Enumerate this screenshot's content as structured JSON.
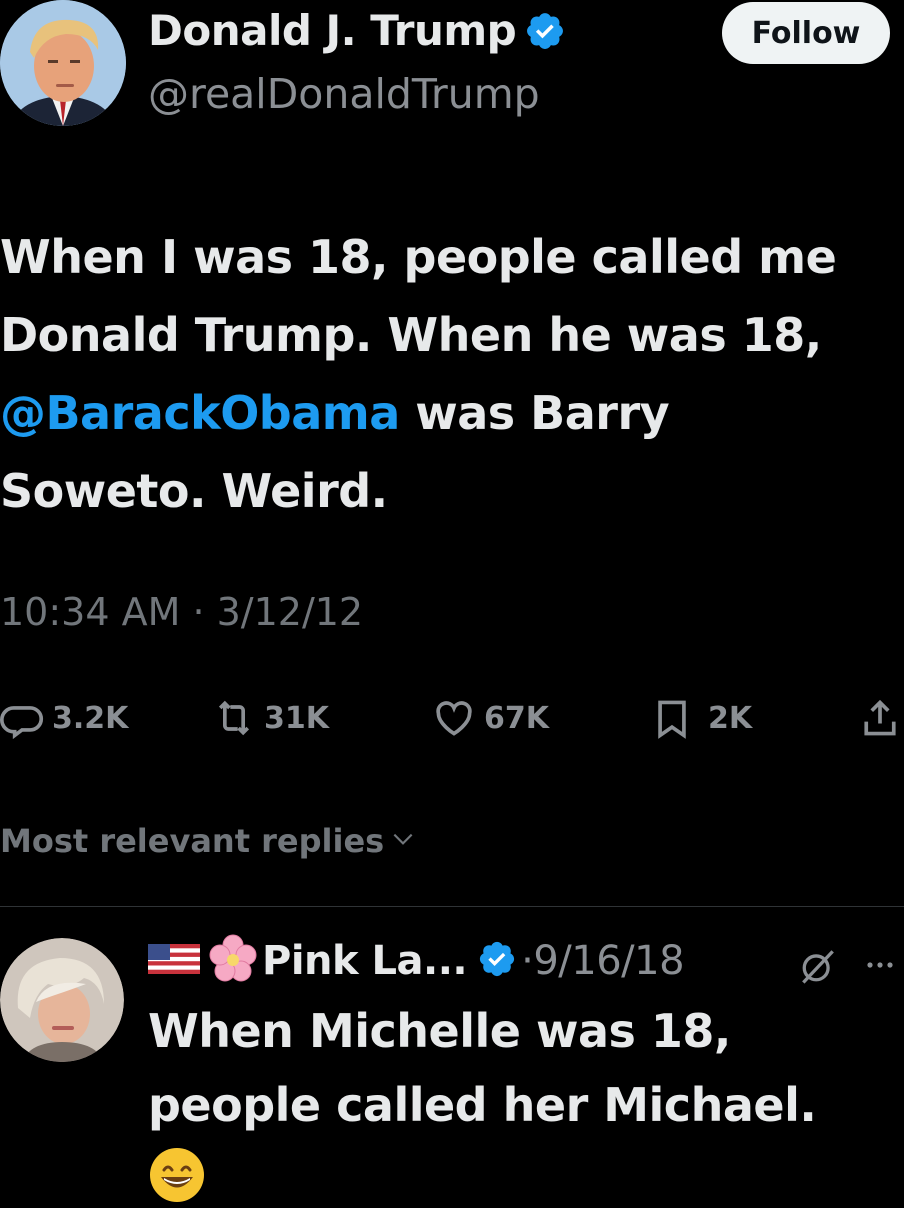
{
  "tweet": {
    "author": {
      "display_name": "Donald J. Trump",
      "handle": "@realDonaldTrump",
      "verified": true
    },
    "follow_label": "Follow",
    "text_lines": [
      "When I was 18, people called me",
      "Donald Trump. When he was 18,"
    ],
    "mention": "@BarackObama",
    "line3_rest": " was Barry",
    "line4": "Soweto. Weird.",
    "timestamp": "10:34 AM · 3/12/12",
    "stats": {
      "replies": "3.2K",
      "reposts": "31K",
      "likes": "67K",
      "bookmarks": "2K"
    },
    "icons": {
      "reply": "comment-icon",
      "repost": "repost-icon",
      "like": "heart-icon",
      "bookmark": "bookmark-icon",
      "share": "share-icon"
    }
  },
  "replies_sort_label": "Most relevant replies",
  "reply": {
    "display_name": "Pink La...",
    "date": "·9/16/18",
    "verified": true,
    "text_lines": [
      "When Michelle was 18,",
      "people called her Michael."
    ],
    "emoji": "😁"
  },
  "colors": {
    "background": "#000000",
    "text": "#e7e9ea",
    "secondary": "#71767b",
    "link": "#1d9bf0",
    "verified": "#1d9bf0",
    "follow_button_bg": "#eff3f4"
  }
}
